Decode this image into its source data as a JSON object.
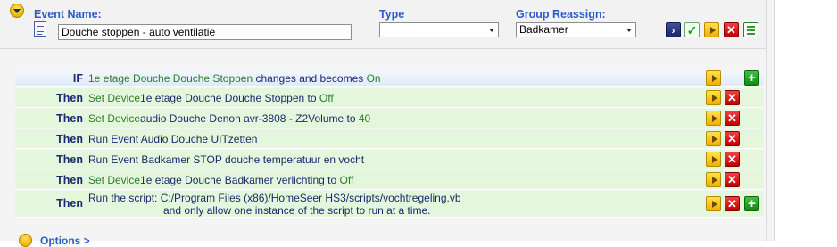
{
  "header": {
    "event_name_label": "Event Name:",
    "event_name_value": "Douche stoppen - auto ventilatie",
    "type_label": "Type",
    "type_value": "",
    "group_label": "Group Reassign:",
    "group_value": "Badkamer"
  },
  "if_row": {
    "keyword": "IF",
    "device": "1e etage Douche Douche Stoppen",
    "text1": "changes and becomes",
    "value": "On"
  },
  "then_rows": [
    {
      "keyword": "Then",
      "action": "Set Device",
      "target": "1e etage Douche Douche Stoppen",
      "mid": "to",
      "value": "Off"
    },
    {
      "keyword": "Then",
      "action": "Set Device",
      "target": "audio Douche Denon avr-3808 - Z2Volume",
      "mid": "to",
      "value": "40"
    },
    {
      "keyword": "Then",
      "action": "Run Event",
      "target": "Audio Douche UITzetten",
      "mid": "",
      "value": ""
    },
    {
      "keyword": "Then",
      "action": "Run Event",
      "target": "Badkamer STOP douche temperatuur en vocht",
      "mid": "",
      "value": ""
    },
    {
      "keyword": "Then",
      "action": "Set Device",
      "target": "1e etage Douche Badkamer verlichting",
      "mid": "to",
      "value": "Off"
    },
    {
      "keyword": "Then",
      "action": "Run the script:",
      "target": "C:/Program Files (x86)/HomeSeer HS3/scripts/vochtregeling.vb",
      "line2": "and only allow one instance of the script to run at a time."
    }
  ],
  "options_label": "Options >",
  "icons": [
    "collapse-icon",
    "document-icon",
    "go-icon",
    "checkmark-icon",
    "run-icon",
    "delete-icon",
    "spreadsheet-icon",
    "add-icon"
  ]
}
